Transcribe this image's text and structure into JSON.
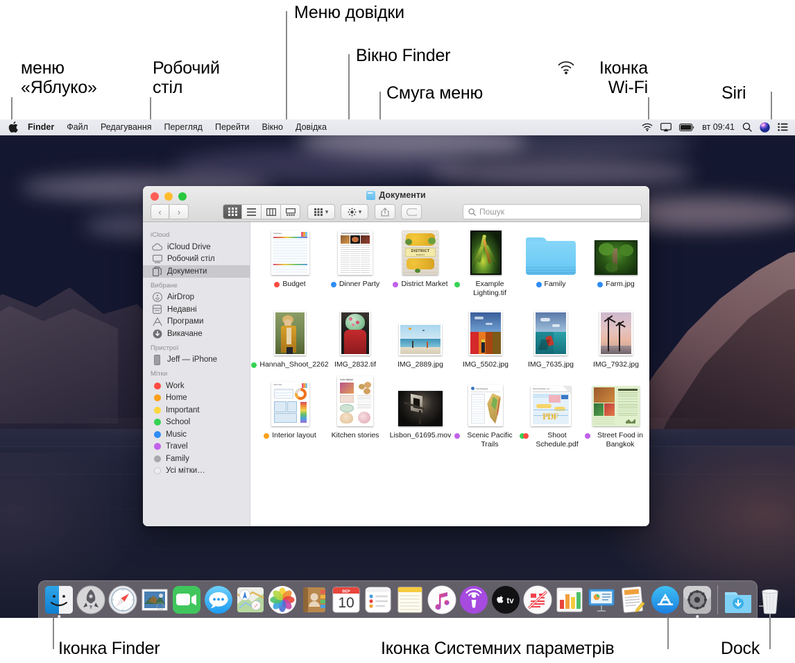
{
  "callouts": [
    {
      "id": "apple-menu",
      "text": "меню\n«Яблуко»"
    },
    {
      "id": "desktop",
      "text": "Робочий\nстіл"
    },
    {
      "id": "help-menu",
      "text": "Меню довідки"
    },
    {
      "id": "finder-window",
      "text": "Вікно Finder"
    },
    {
      "id": "menu-bar",
      "text": "Смуга меню"
    },
    {
      "id": "wifi-icon",
      "text": "Іконка\nWi-Fi"
    },
    {
      "id": "siri",
      "text": "Siri"
    },
    {
      "id": "finder-icon",
      "text": "Іконка Finder"
    },
    {
      "id": "sys-prefs",
      "text": "Іконка Системних параметрів"
    },
    {
      "id": "dock",
      "text": "Dock"
    }
  ],
  "menubar": {
    "apple_icon": "apple-icon",
    "items": [
      {
        "label": "Finder",
        "bold": true
      },
      {
        "label": "Файл",
        "bold": false
      },
      {
        "label": "Редагування",
        "bold": false
      },
      {
        "label": "Перегляд",
        "bold": false
      },
      {
        "label": "Перейти",
        "bold": false
      },
      {
        "label": "Вікно",
        "bold": false
      },
      {
        "label": "Довідка",
        "bold": false
      }
    ],
    "status": {
      "wifi_icon": "wifi-icon",
      "airplay_icon": "airplay-icon",
      "battery_icon": "battery-icon",
      "clock": "вт 09:41",
      "search_icon": "spotlight-search-icon",
      "siri_icon": "siri-icon",
      "control_center_icon": "control-center-icon"
    }
  },
  "finder": {
    "title": "Документи",
    "traffic_lights": [
      "close",
      "minimize",
      "zoom"
    ],
    "toolbar": {
      "back_icon": "chevron-left-icon",
      "forward_icon": "chevron-right-icon",
      "view_icon_grid": "icon-view-icon",
      "view_list": "list-view-icon",
      "view_column": "column-view-icon",
      "view_gallery": "gallery-view-icon",
      "group_icon": "group-by-icon",
      "action_icon": "gear-icon",
      "share_icon": "share-icon",
      "tags_icon": "tag-icon",
      "search_placeholder": "Пошук",
      "search_value": "",
      "search_icon": "search-icon"
    },
    "sidebar": [
      {
        "header": "iCloud",
        "items": [
          {
            "label": "iCloud Drive",
            "icon": "cloud-icon",
            "selected": false
          },
          {
            "label": "Робочий стіл",
            "icon": "desktop-icon",
            "selected": false
          },
          {
            "label": "Документи",
            "icon": "documents-icon",
            "selected": true
          }
        ]
      },
      {
        "header": "Вибране",
        "items": [
          {
            "label": "AirDrop",
            "icon": "airdrop-icon",
            "selected": false
          },
          {
            "label": "Недавні",
            "icon": "recents-icon",
            "selected": false
          },
          {
            "label": "Програми",
            "icon": "applications-icon",
            "selected": false
          },
          {
            "label": "Викачане",
            "icon": "downloads-icon",
            "selected": false
          }
        ]
      },
      {
        "header": "Пристрої",
        "items": [
          {
            "label": "Jeff — iPhone",
            "icon": "iphone-icon",
            "selected": false
          }
        ]
      },
      {
        "header": "Мітки",
        "items": [
          {
            "label": "Work",
            "icon": "tag-dot",
            "color": "#fc4b42",
            "selected": false
          },
          {
            "label": "Home",
            "icon": "tag-dot",
            "color": "#f9a01b",
            "selected": false
          },
          {
            "label": "Important",
            "icon": "tag-dot",
            "color": "#fcd53f",
            "selected": false
          },
          {
            "label": "School",
            "icon": "tag-dot",
            "color": "#36d254",
            "selected": false
          },
          {
            "label": "Music",
            "icon": "tag-dot",
            "color": "#2e8cf5",
            "selected": false
          },
          {
            "label": "Travel",
            "icon": "tag-dot",
            "color": "#c160ea",
            "selected": false
          },
          {
            "label": "Family",
            "icon": "tag-dot",
            "color": "#a8a8ad",
            "selected": false
          },
          {
            "label": "Усі мітки…",
            "icon": "tag-dot-outline",
            "color": "#e3e3e5",
            "selected": false
          }
        ]
      }
    ],
    "files": [
      [
        {
          "name": "Budget",
          "dots": [
            "#fc4b42"
          ],
          "kind": "spreadsheet"
        },
        {
          "name": "Dinner Party",
          "dots": [
            "#2e8cf5"
          ],
          "kind": "menu-doc"
        },
        {
          "name": "District Market",
          "dots": [
            "#c160ea"
          ],
          "kind": "poster"
        },
        {
          "name": "Example Lighting.tif",
          "dots": [
            "#36d254"
          ],
          "kind": "photo-leaf"
        },
        {
          "name": "Family",
          "dots": [
            "#2e8cf5"
          ],
          "kind": "folder"
        },
        {
          "name": "Farm.jpg",
          "dots": [
            "#2e8cf5"
          ],
          "kind": "photo-tree"
        }
      ],
      [
        {
          "name": "Hannah_Shoot_2262",
          "dots": [
            "#36d254"
          ],
          "kind": "photo-portrait"
        },
        {
          "name": "IMG_2832.tif",
          "dots": [],
          "kind": "photo-hat"
        },
        {
          "name": "IMG_2889.jpg",
          "dots": [],
          "kind": "photo-beach"
        },
        {
          "name": "IMG_5502.jpg",
          "dots": [],
          "kind": "photo-wall"
        },
        {
          "name": "IMG_7635.jpg",
          "dots": [],
          "kind": "photo-jump"
        },
        {
          "name": "IMG_7932.jpg",
          "dots": [],
          "kind": "photo-sunset"
        }
      ],
      [
        {
          "name": "Interior layout",
          "dots": [
            "#f9a01b"
          ],
          "kind": "layout-doc"
        },
        {
          "name": "Kitchen stories",
          "dots": [],
          "kind": "recipe-doc"
        },
        {
          "name": "Lisbon_61695.mov",
          "dots": [],
          "kind": "video-dark"
        },
        {
          "name": "Scenic Pacific Trails",
          "dots": [
            "#c160ea"
          ],
          "kind": "map-doc"
        },
        {
          "name": "Shoot Schedule.pdf",
          "dots": [
            "#36d254",
            "#fc4b42"
          ],
          "kind": "pdf-doc"
        },
        {
          "name": "Street Food in Bangkok",
          "dots": [
            "#c160ea"
          ],
          "kind": "green-doc"
        }
      ]
    ]
  },
  "dock": {
    "apps": [
      {
        "name": "Finder",
        "icon": "finder-icon",
        "running": true
      },
      {
        "name": "Launchpad",
        "icon": "launchpad-icon",
        "running": false
      },
      {
        "name": "Safari",
        "icon": "safari-icon",
        "running": false
      },
      {
        "name": "Mail",
        "icon": "mail-icon",
        "running": false
      },
      {
        "name": "FaceTime",
        "icon": "facetime-icon",
        "running": false
      },
      {
        "name": "Messages",
        "icon": "messages-icon",
        "running": false
      },
      {
        "name": "Maps",
        "icon": "maps-icon",
        "running": false
      },
      {
        "name": "Photos",
        "icon": "photos-icon",
        "running": false
      },
      {
        "name": "Contacts",
        "icon": "contacts-icon",
        "running": false
      },
      {
        "name": "Calendar",
        "icon": "calendar-icon",
        "running": false,
        "month": "ВЕР",
        "day": "10"
      },
      {
        "name": "Reminders",
        "icon": "reminders-icon",
        "running": false
      },
      {
        "name": "Notes",
        "icon": "notes-icon",
        "running": false
      },
      {
        "name": "Music",
        "icon": "music-icon",
        "running": false
      },
      {
        "name": "Podcasts",
        "icon": "podcasts-icon",
        "running": false
      },
      {
        "name": "Apple TV",
        "icon": "appletv-icon",
        "running": false
      },
      {
        "name": "News",
        "icon": "news-icon",
        "running": false
      },
      {
        "name": "Numbers",
        "icon": "numbers-icon",
        "running": false
      },
      {
        "name": "Keynote",
        "icon": "keynote-icon",
        "running": false
      },
      {
        "name": "Pages",
        "icon": "pages-icon",
        "running": false
      },
      {
        "name": "App Store",
        "icon": "appstore-icon",
        "running": false
      },
      {
        "name": "System Preferences",
        "icon": "system-preferences-icon",
        "running": true
      }
    ],
    "others": [
      {
        "name": "Downloads",
        "icon": "downloads-folder-icon"
      },
      {
        "name": "Trash",
        "icon": "trash-icon"
      }
    ]
  }
}
